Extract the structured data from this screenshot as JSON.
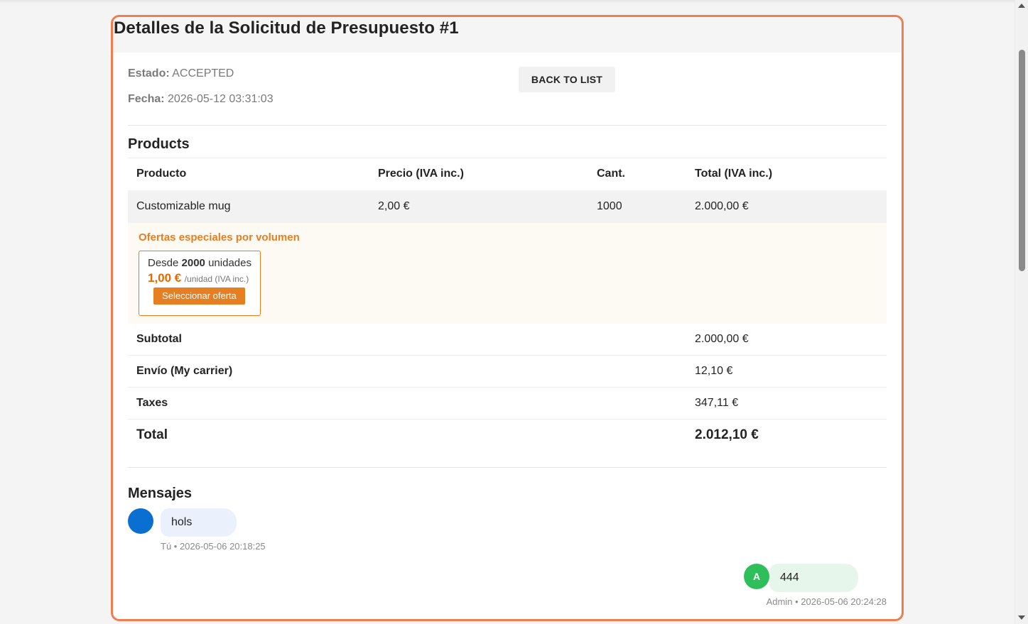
{
  "header": {
    "title": "Detalles de la Solicitud de Presupuesto #1"
  },
  "info": {
    "status_label": "Estado:",
    "status_value": "ACCEPTED",
    "date_label": "Fecha:",
    "date_value": "2026-05-12 03:31:03",
    "back_button": "BACK TO LIST"
  },
  "products": {
    "title": "Products",
    "columns": [
      "Producto",
      "Precio (IVA inc.)",
      "Cant.",
      "Total (IVA inc.)"
    ],
    "rows": [
      {
        "name": "Customizable mug",
        "price": "2,00 €",
        "qty": "1000",
        "total": "2.000,00 €"
      }
    ],
    "offers": {
      "title": "Ofertas especiales por volumen",
      "items": [
        {
          "from_prefix": "Desde",
          "from_qty": "2000",
          "from_suffix": "unidades",
          "price": "1,00 €",
          "unit": "/unidad (IVA inc.)",
          "button": "Seleccionar oferta"
        }
      ]
    },
    "summary": [
      {
        "label": "Subtotal",
        "value": "2.000,00 €"
      },
      {
        "label": "Envío (My carrier)",
        "value": "12,10 €"
      },
      {
        "label": "Taxes",
        "value": "347,11 €"
      }
    ],
    "total": {
      "label": "Total",
      "value": "2.012,10 €"
    }
  },
  "messages": {
    "title": "Mensajes",
    "items": [
      {
        "text": "hols",
        "author": "Tú",
        "time": "2026-05-06 20:18:25",
        "avatar": "",
        "color": "#0a6fd1",
        "bubble_color": "#eaf1fd"
      },
      {
        "text": "444",
        "author": "Admin",
        "time": "2026-05-06 20:24:28",
        "avatar": "A",
        "color": "#2fbf5a",
        "bubble_color": "#e7f6ea"
      }
    ]
  },
  "colors": {
    "accent_border": "#ef7d4f",
    "offer_accent": "#e67e22"
  }
}
